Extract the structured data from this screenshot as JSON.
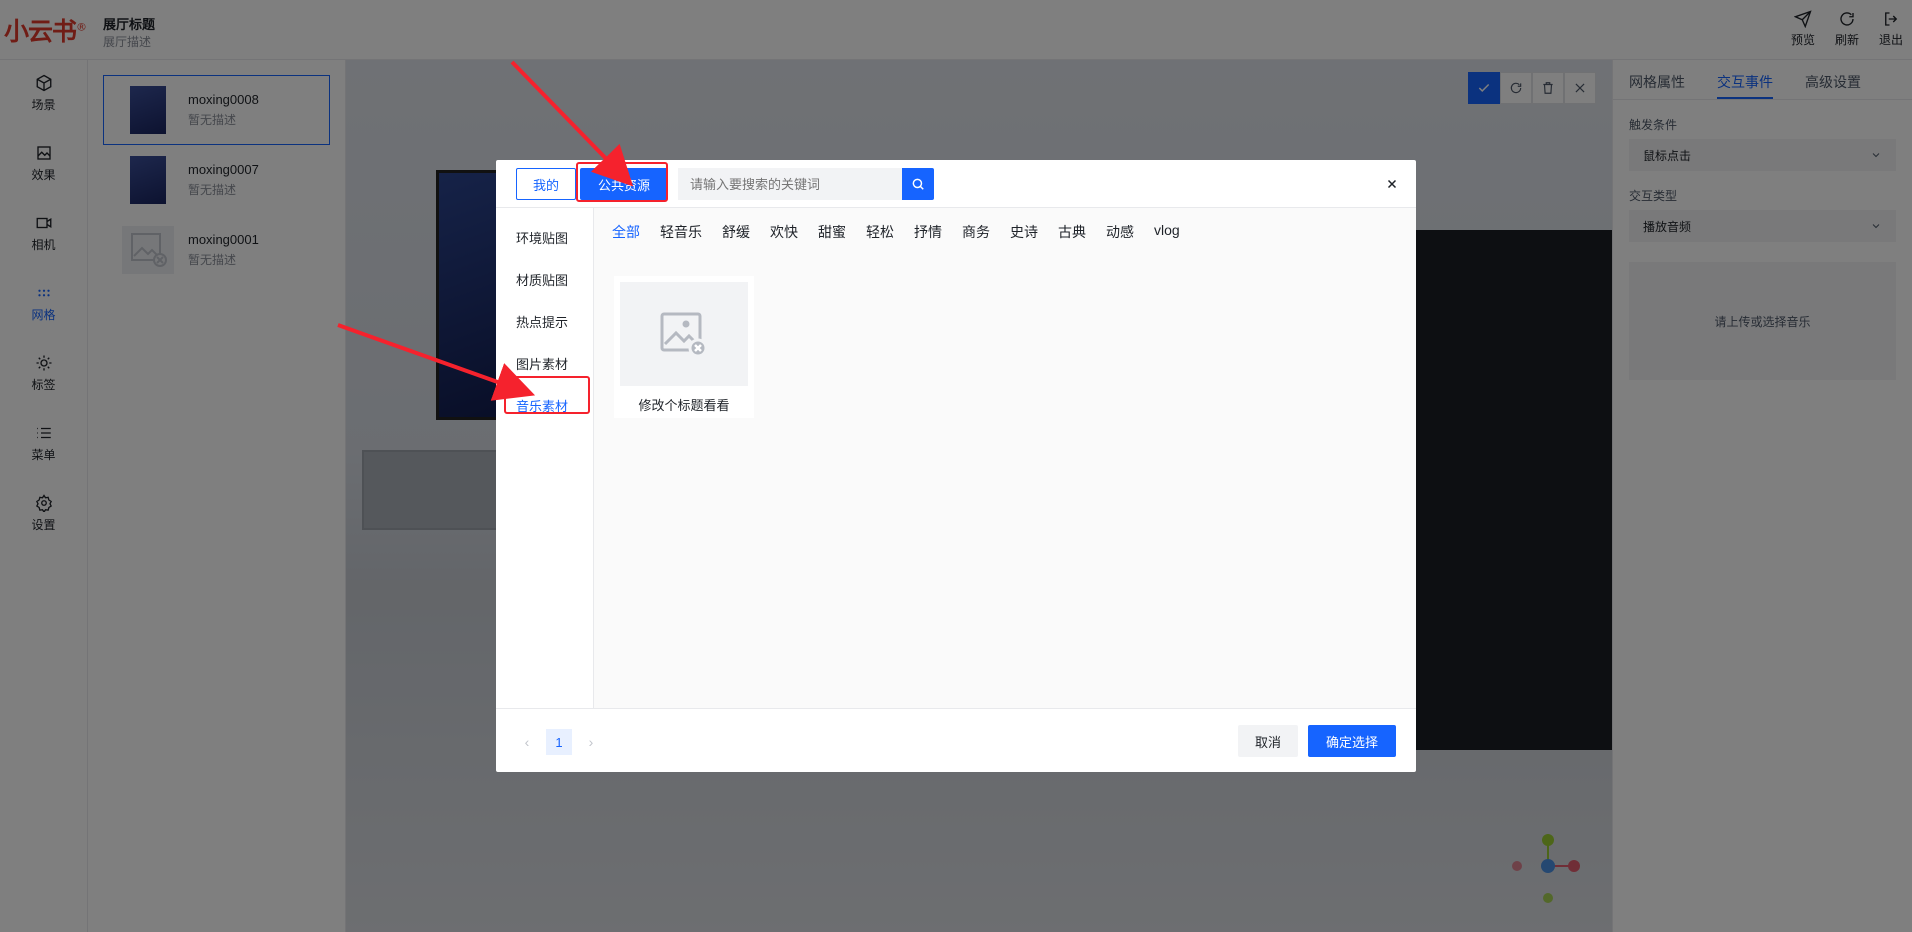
{
  "app": {
    "logo": "小云书",
    "logo_mark": "®",
    "hall_title": "展厅标题",
    "hall_desc": "展厅描述"
  },
  "top_actions": [
    {
      "label": "预览",
      "icon": "send-icon"
    },
    {
      "label": "刷新",
      "icon": "refresh-icon"
    },
    {
      "label": "退出",
      "icon": "logout-icon"
    }
  ],
  "nav": [
    {
      "label": "场景",
      "icon": "cube-icon"
    },
    {
      "label": "效果",
      "icon": "image-icon"
    },
    {
      "label": "相机",
      "icon": "camera-icon"
    },
    {
      "label": "网格",
      "icon": "grid-icon",
      "active": true
    },
    {
      "label": "标签",
      "icon": "tag-icon"
    },
    {
      "label": "菜单",
      "icon": "menu-icon"
    },
    {
      "label": "设置",
      "icon": "gear-icon"
    }
  ],
  "models": [
    {
      "name": "moxing0008",
      "desc": "暂无描述",
      "selected": true
    },
    {
      "name": "moxing0007",
      "desc": "暂无描述"
    },
    {
      "name": "moxing0001",
      "desc": "暂无描述",
      "placeholder": true
    }
  ],
  "right_panel": {
    "tabs": [
      "网格属性",
      "交互事件",
      "高级设置"
    ],
    "active_tab": "交互事件",
    "trigger_label": "触发条件",
    "trigger_value": "鼠标点击",
    "type_label": "交互类型",
    "type_value": "播放音频",
    "upload_hint": "请上传或选择音乐"
  },
  "dialog": {
    "tab_mine": "我的",
    "tab_public": "公共资源",
    "search_placeholder": "请输入要搜索的关键词",
    "sidebar": [
      "环境贴图",
      "材质贴图",
      "热点提示",
      "图片素材",
      "音乐素材"
    ],
    "sidebar_active": "音乐素材",
    "categories": [
      "全部",
      "轻音乐",
      "舒缓",
      "欢快",
      "甜蜜",
      "轻松",
      "抒情",
      "商务",
      "史诗",
      "古典",
      "动感",
      "vlog"
    ],
    "category_active": "全部",
    "items": [
      {
        "title": "修改个标题看看"
      }
    ],
    "page": "1",
    "cancel": "取消",
    "confirm": "确定选择"
  },
  "colors": {
    "primary": "#1664ff",
    "annotation": "#f5222d",
    "logo": "#e03b2d"
  }
}
